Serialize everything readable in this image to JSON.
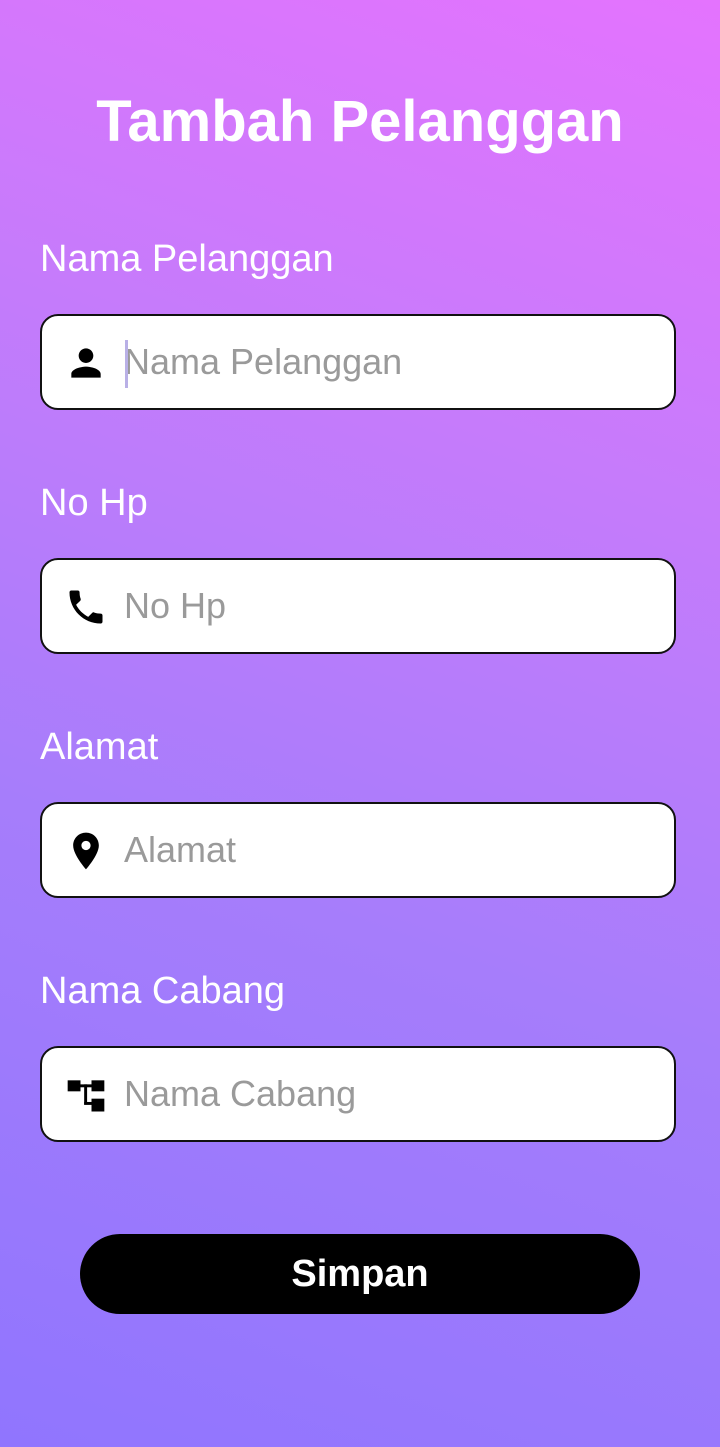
{
  "page": {
    "title": "Tambah Pelanggan"
  },
  "fields": [
    {
      "label": "Nama Pelanggan",
      "placeholder": "Nama Pelanggan",
      "value": "",
      "icon": "person-icon"
    },
    {
      "label": "No Hp",
      "placeholder": "No Hp",
      "value": "",
      "icon": "phone-icon"
    },
    {
      "label": "Alamat",
      "placeholder": "Alamat",
      "value": "",
      "icon": "location-pin-icon"
    },
    {
      "label": "Nama Cabang",
      "placeholder": "Nama Cabang",
      "value": "",
      "icon": "branch-tree-icon"
    }
  ],
  "actions": {
    "save_label": "Simpan"
  },
  "colors": {
    "gradient_top": "#e473fe",
    "gradient_bottom": "#9075fe",
    "button_bg": "#000000",
    "text_light": "#ffffff",
    "placeholder": "#9a9a9a"
  }
}
